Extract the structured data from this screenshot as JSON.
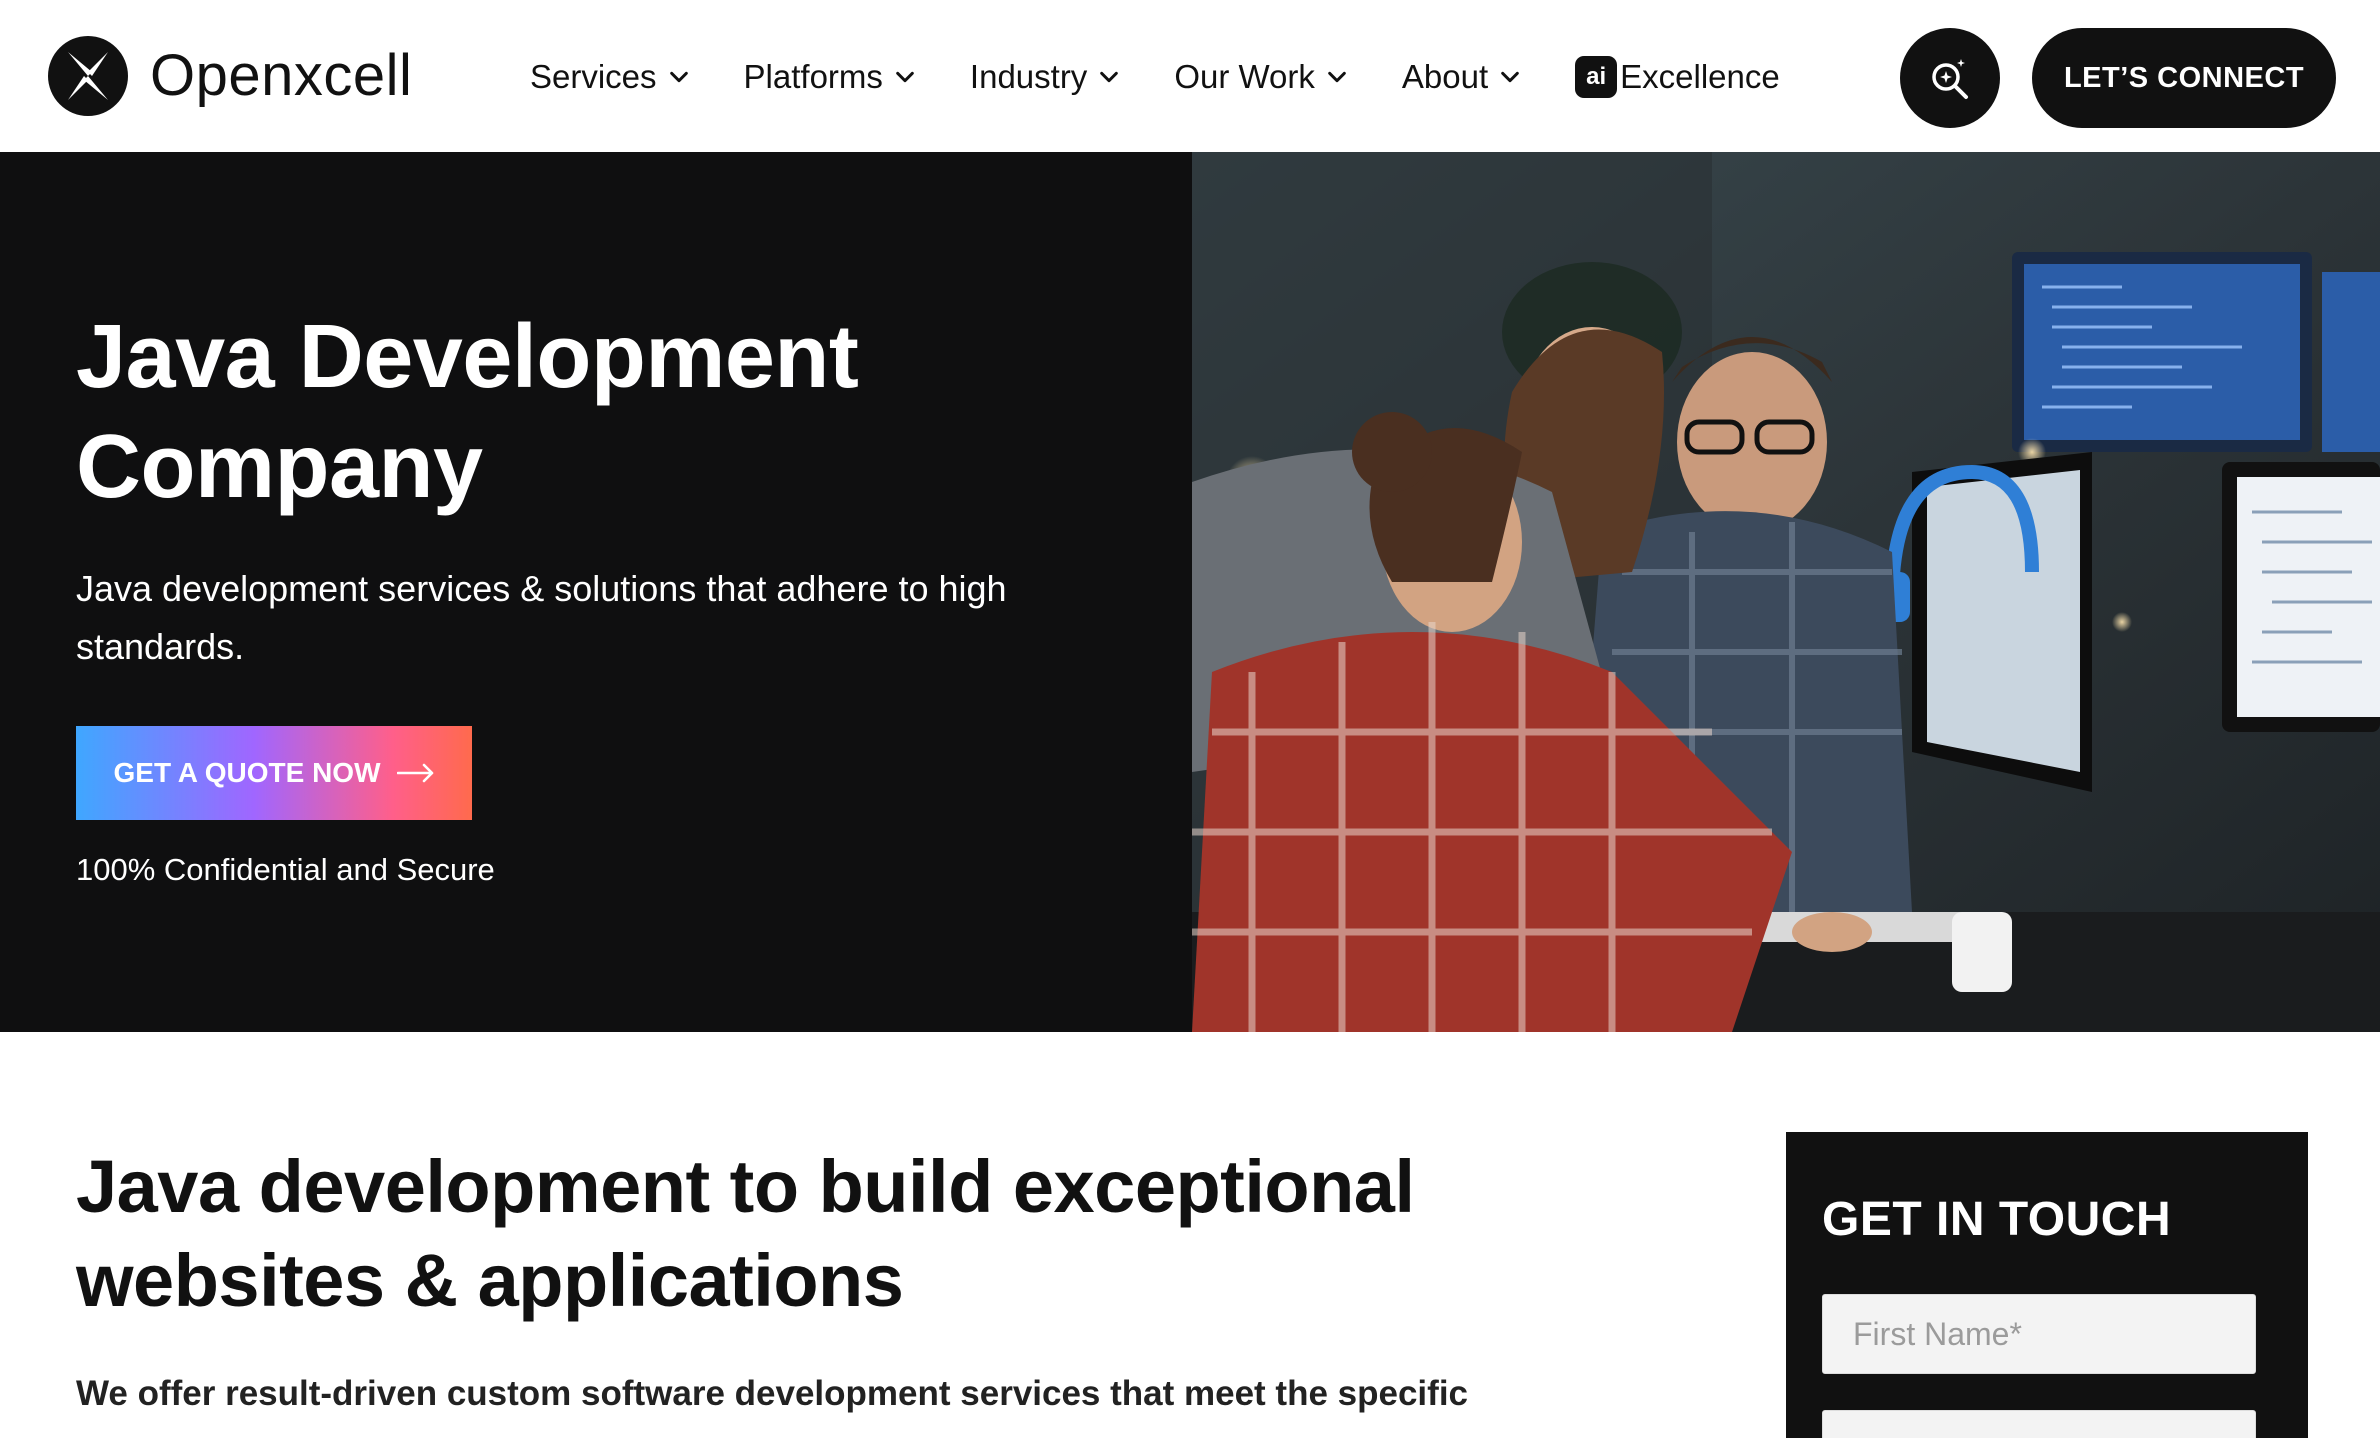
{
  "header": {
    "logo_text": "Openxcell",
    "nav": [
      {
        "label": "Services"
      },
      {
        "label": "Platforms"
      },
      {
        "label": "Industry"
      },
      {
        "label": "Our Work"
      },
      {
        "label": "About"
      }
    ],
    "ai_nav": {
      "badge": "ai",
      "label": "Excellence"
    },
    "search_icon": "ai-search-icon",
    "connect_label": "LET’S CONNECT"
  },
  "hero": {
    "title": "Java Development Company",
    "subtitle": "Java development services & solutions that adhere to high standards.",
    "cta_label": "GET A QUOTE NOW",
    "note": "100% Confidential and Secure",
    "image_alt": "team-at-computer-photo"
  },
  "content": {
    "title": "Java development to build exceptional websites & applications",
    "lead": "We offer result-driven custom software development services that meet the specific"
  },
  "contact": {
    "title": "GET IN TOUCH",
    "first_name_placeholder": "First Name*"
  },
  "colors": {
    "dark": "#0f0f10",
    "gradient": [
      "#3fa7ff",
      "#a066ff",
      "#ff5f8a",
      "#ff6a4d"
    ]
  }
}
